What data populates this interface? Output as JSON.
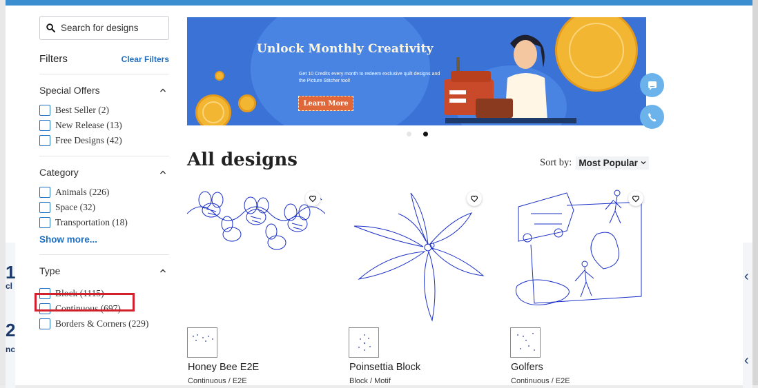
{
  "search": {
    "placeholder": "Search for designs",
    "icon": "search-icon"
  },
  "filters": {
    "title": "Filters",
    "clear_label": "Clear Filters",
    "sections": [
      {
        "title": "Special Offers",
        "options": [
          "Best Seller (2)",
          "New Release (13)",
          "Free Designs (42)"
        ]
      },
      {
        "title": "Category",
        "options": [
          "Animals (226)",
          "Space (32)",
          "Transportation (18)"
        ],
        "show_more": "Show more..."
      },
      {
        "title": "Type",
        "options": [
          "Block (1115)",
          "Continuous (697)",
          "Borders & Corners (229)"
        ],
        "highlighted": "Continuous (697)"
      }
    ]
  },
  "banner": {
    "title": "Unlock Monthly Creativity",
    "subtitle": "Get 10 Credits every month to redeem exclusive quilt designs and the Picture Stitcher tool!",
    "button_label": "Learn More",
    "slides": 2,
    "active_slide": 2
  },
  "main": {
    "title": "All designs",
    "sort_label": "Sort by:",
    "sort_value": "Most Popular"
  },
  "products": [
    {
      "name": "Honey Bee E2E",
      "type": "Continuous / E2E"
    },
    {
      "name": "Poinsettia Block",
      "type": "Block / Motif"
    },
    {
      "name": "Golfers",
      "type": "Continuous / E2E"
    }
  ],
  "colors": {
    "accent": "#1f6fc1",
    "banner_bg": "#3a72d6",
    "highlight": "#d3202e",
    "line_art": "#1a2fc7"
  },
  "background_page": {
    "left_chars": [
      "1",
      "cl",
      "2",
      "nc"
    ]
  }
}
